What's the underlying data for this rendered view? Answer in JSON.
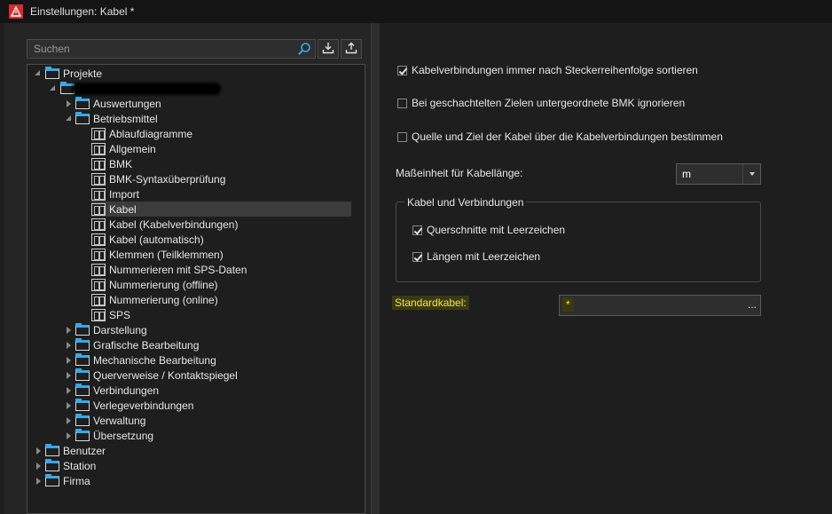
{
  "window": {
    "title": "Einstellungen: Kabel *"
  },
  "search": {
    "placeholder": "Suchen"
  },
  "tree": {
    "projekte": "Projekte",
    "auswertungen": "Auswertungen",
    "betriebsmittel": "Betriebsmittel",
    "ablaufdiagramme": "Ablaufdiagramme",
    "allgemein": "Allgemein",
    "bmk": "BMK",
    "bmk_syntax": "BMK-Syntaxüberprüfung",
    "import": "Import",
    "kabel": "Kabel",
    "kabel_verbindungen": "Kabel (Kabelverbindungen)",
    "kabel_automatisch": "Kabel (automatisch)",
    "klemmen": "Klemmen (Teilklemmen)",
    "nummerieren_sps": "Nummerieren mit SPS-Daten",
    "nummerierung_offline": "Nummerierung (offline)",
    "nummerierung_online": "Nummerierung (online)",
    "sps": "SPS",
    "darstellung": "Darstellung",
    "grafische_bearbeitung": "Grafische Bearbeitung",
    "mechanische_bearbeitung": "Mechanische Bearbeitung",
    "querverweise": "Querverweise / Kontaktspiegel",
    "verbindungen": "Verbindungen",
    "verlegeverbindungen": "Verlegeverbindungen",
    "verwaltung": "Verwaltung",
    "uebersetzung": "Übersetzung",
    "benutzer": "Benutzer",
    "station": "Station",
    "firma": "Firma"
  },
  "settings": {
    "sort_by_plug": "Kabelverbindungen immer nach Steckerreihenfolge sortieren",
    "ignore_bmk": "Bei geschachtelten Zielen untergeordnete BMK ignorieren",
    "source_target": "Quelle und Ziel der Kabel über die Kabelverbindungen bestimmen",
    "unit_label": "Maßeinheit für Kabellänge:",
    "unit_value": "m",
    "group_title": "Kabel und Verbindungen",
    "cross_sections": "Querschnitte mit Leerzeichen",
    "lengths": "Längen mit Leerzeichen",
    "standard_label": "Standardkabel:",
    "standard_value": "*",
    "browse": "..."
  },
  "colors": {
    "accent": "#38a8e8",
    "highlight": "#f0e84a",
    "app_icon": "#d92b2b"
  }
}
